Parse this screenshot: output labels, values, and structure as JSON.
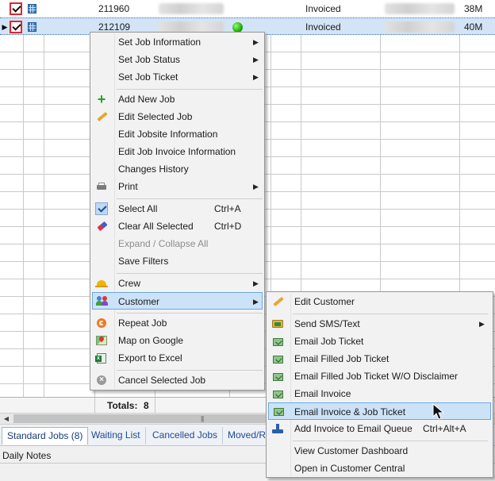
{
  "grid": {
    "rows": [
      {
        "indicator": "",
        "job_no": "211960",
        "status": "Invoiced",
        "size": "38M",
        "has_dot": false
      },
      {
        "indicator": "▶",
        "job_no": "212109",
        "status": "Invoiced",
        "size": "40M",
        "has_dot": true
      }
    ],
    "totals_label": "Totals:",
    "totals_value": "8",
    "scroll_grip": "|||"
  },
  "tabs": [
    "Standard Jobs (8)",
    "Waiting List",
    "Cancelled Jobs",
    "Moved/Ro"
  ],
  "notes_label": "Daily Notes",
  "context_menu": {
    "items": [
      {
        "label": "Set Job Information",
        "submenu": true,
        "icon": "none"
      },
      {
        "label": "Set Job Status",
        "submenu": true,
        "icon": "none"
      },
      {
        "label": "Set Job Ticket",
        "submenu": true,
        "icon": "none"
      },
      {
        "label": "Add New Job",
        "icon": "plus-icon"
      },
      {
        "label": "Edit Selected Job",
        "icon": "pencil-icon"
      },
      {
        "label": "Edit Jobsite Information",
        "icon": "none"
      },
      {
        "label": "Edit Job Invoice Information",
        "icon": "none"
      },
      {
        "label": "Changes History",
        "icon": "none"
      },
      {
        "label": "Print",
        "submenu": true,
        "icon": "printer-icon"
      },
      {
        "label": "Select All",
        "shortcut": "Ctrl+A",
        "icon": "checkmark-icon"
      },
      {
        "label": "Clear All Selected",
        "shortcut": "Ctrl+D",
        "icon": "eraser-icon"
      },
      {
        "label": "Expand / Collapse All",
        "disabled": true,
        "icon": "none"
      },
      {
        "label": "Save Filters",
        "icon": "none"
      },
      {
        "label": "Crew",
        "submenu": true,
        "icon": "hardhat-icon"
      },
      {
        "label": "Customer",
        "submenu": true,
        "highlighted": true,
        "icon": "people-icon"
      },
      {
        "label": "Repeat Job",
        "icon": "repeat-icon"
      },
      {
        "label": "Map on Google",
        "icon": "map-icon"
      },
      {
        "label": "Export to Excel",
        "icon": "excel-icon"
      },
      {
        "label": "Cancel Selected Job",
        "icon": "cancel-icon"
      }
    ]
  },
  "customer_submenu": {
    "items": [
      {
        "label": "Edit Customer",
        "icon": "pencil-icon"
      },
      {
        "label": "Send SMS/Text",
        "submenu": true,
        "icon": "sms-icon"
      },
      {
        "label": "Email Job Ticket",
        "icon": "email-icon"
      },
      {
        "label": "Email Filled Job Ticket",
        "icon": "email-icon"
      },
      {
        "label": "Email Filled Job Ticket W/O Disclaimer",
        "icon": "email-icon"
      },
      {
        "label": "Email Invoice",
        "icon": "email-icon"
      },
      {
        "label": "Email Invoice & Job Ticket",
        "highlighted": true,
        "icon": "email-icon"
      },
      {
        "label": "Add Invoice to Email Queue",
        "shortcut": "Ctrl+Alt+A",
        "icon": "queue-icon"
      },
      {
        "label": "View Customer Dashboard",
        "icon": "none"
      },
      {
        "label": "Open in Customer Central",
        "icon": "none"
      }
    ]
  },
  "colors": {
    "highlight": "#cce2f7",
    "selected_row": "#d3e4f6",
    "checkbox_border": "#e0262c",
    "status_dot": "#19a300"
  }
}
